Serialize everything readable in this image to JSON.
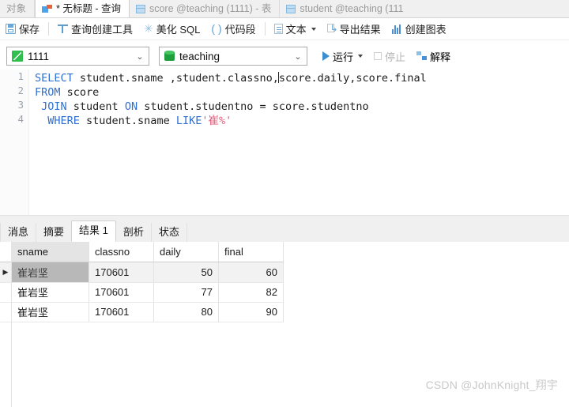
{
  "window": {
    "tabs": [
      {
        "label": "对象",
        "icon": "none",
        "active": false
      },
      {
        "label": "* 无标题 - 查询",
        "icon": "query-icon",
        "active": true
      },
      {
        "label": "score @teaching (1111) - 表",
        "icon": "table-icon",
        "active": false
      },
      {
        "label": "student @teaching (111",
        "icon": "table-icon",
        "active": false
      }
    ]
  },
  "toolbar": {
    "items": [
      {
        "label": "保存",
        "icon": "save-icon",
        "name": "save-button",
        "disabled": false
      },
      {
        "label": "查询创建工具",
        "icon": "query-builder-icon",
        "name": "query-builder-button",
        "disabled": false
      },
      {
        "label": "美化 SQL",
        "icon": "beautify-icon",
        "name": "beautify-sql-button",
        "disabled": false
      },
      {
        "label": "代码段",
        "icon": "snippet-icon",
        "name": "code-snippet-button",
        "disabled": false
      },
      {
        "label": "文本",
        "icon": "text-icon",
        "name": "text-button",
        "disabled": false
      },
      {
        "label": "导出结果",
        "icon": "export-icon",
        "name": "export-result-button",
        "disabled": false
      },
      {
        "label": "创建图表",
        "icon": "chart-icon",
        "name": "create-chart-button",
        "disabled": false
      }
    ]
  },
  "connection_bar": {
    "connection": {
      "value": "1111",
      "icon": "connection-icon"
    },
    "database": {
      "value": "teaching",
      "icon": "database-icon"
    },
    "run_label": "运行",
    "stop_label": "停止",
    "explain_label": "解释"
  },
  "editor": {
    "line_numbers": [
      "1",
      "2",
      "3",
      "4"
    ],
    "lines": [
      {
        "indent": "",
        "tokens": [
          {
            "t": "SELECT",
            "k": "kw"
          },
          {
            "t": " student.sname ,student.classno,",
            "k": ""
          },
          {
            "t": "|CARET|",
            "k": "caret"
          },
          {
            "t": "score.daily,score.final",
            "k": ""
          }
        ]
      },
      {
        "indent": "",
        "tokens": [
          {
            "t": "FROM",
            "k": "kw"
          },
          {
            "t": " score",
            "k": ""
          }
        ]
      },
      {
        "indent": " ",
        "tokens": [
          {
            "t": "JOIN",
            "k": "kw"
          },
          {
            "t": " student ",
            "k": ""
          },
          {
            "t": "ON",
            "k": "kw"
          },
          {
            "t": " student.studentno = score.studentno",
            "k": ""
          }
        ]
      },
      {
        "indent": "  ",
        "tokens": [
          {
            "t": "WHERE",
            "k": "kw"
          },
          {
            "t": " student.sname ",
            "k": ""
          },
          {
            "t": "LIKE",
            "k": "kw"
          },
          {
            "t": "'崔%'",
            "k": "str"
          }
        ]
      }
    ],
    "sql_text": "SELECT student.sname ,student.classno,score.daily,score.final\nFROM score\n JOIN student ON student.studentno = score.studentno\n  WHERE student.sname LIKE'崔%'"
  },
  "result_tabs": [
    {
      "label": "消息",
      "active": false
    },
    {
      "label": "摘要",
      "active": false
    },
    {
      "label": "结果 1",
      "active": true
    },
    {
      "label": "剖析",
      "active": false
    },
    {
      "label": "状态",
      "active": false
    }
  ],
  "result_grid": {
    "columns": [
      "sname",
      "classno",
      "daily",
      "final"
    ],
    "selected_column": "sname",
    "rows": [
      {
        "sname": "崔岩坚",
        "classno": "170601",
        "daily": "50",
        "final": "60",
        "selected": true
      },
      {
        "sname": "崔岩坚",
        "classno": "170601",
        "daily": "77",
        "final": "82",
        "selected": false
      },
      {
        "sname": "崔岩坚",
        "classno": "170601",
        "daily": "80",
        "final": "90",
        "selected": false
      }
    ],
    "row_indicator": "▶"
  },
  "watermark": "CSDN @JohnKnight_翔宇",
  "colors": {
    "accent_blue": "#3b8ed0",
    "keyword_blue": "#2f6fd0",
    "string_pink": "#e0607e",
    "green": "#2fbf4f",
    "selection_grey": "#b8b8b8"
  }
}
